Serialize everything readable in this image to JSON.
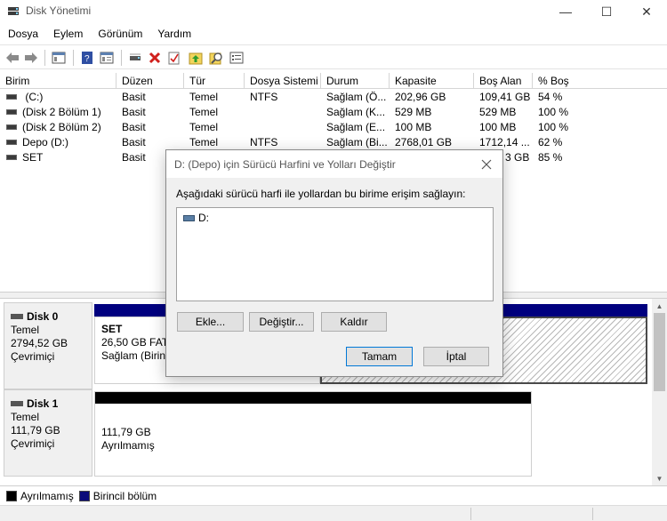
{
  "window": {
    "title": "Disk Yönetimi",
    "minimize_glyph": "—",
    "maximize_glyph": "☐",
    "close_glyph": "✕"
  },
  "menu": [
    "Dosya",
    "Eylem",
    "Görünüm",
    "Yardım"
  ],
  "toolbar": {
    "icons": [
      "back-icon",
      "forward-icon",
      "console-tree-icon",
      "help-icon",
      "properties-icon",
      "connect-icon",
      "delete-icon",
      "checkmark-icon",
      "rescan-icon",
      "search-icon",
      "settings-list-icon"
    ]
  },
  "volume_list": {
    "columns": [
      "Birim",
      "Düzen",
      "Tür",
      "Dosya Sistemi",
      "Durum",
      "Kapasite",
      "Boş Alan",
      "% Boş"
    ],
    "rows": [
      {
        "birim": " (C:)",
        "duzen": "Basit",
        "tur": "Temel",
        "dosya_sistemi": "NTFS",
        "durum": "Sağlam (Ö...",
        "kapasite": "202,96 GB",
        "bos_alan": "109,41 GB",
        "yuzde_bos": "54 %"
      },
      {
        "birim": "(Disk 2 Bölüm 1)",
        "duzen": "Basit",
        "tur": "Temel",
        "dosya_sistemi": "",
        "durum": "Sağlam (K...",
        "kapasite": "529 MB",
        "bos_alan": "529 MB",
        "yuzde_bos": "100 %"
      },
      {
        "birim": "(Disk 2 Bölüm 2)",
        "duzen": "Basit",
        "tur": "Temel",
        "dosya_sistemi": "",
        "durum": "Sağlam (E...",
        "kapasite": "100 MB",
        "bos_alan": "100 MB",
        "yuzde_bos": "100 %"
      },
      {
        "birim": "Depo (D:)",
        "duzen": "Basit",
        "tur": "Temel",
        "dosya_sistemi": "NTFS",
        "durum": "Sağlam (Bi...",
        "kapasite": "2768,01 GB",
        "bos_alan": "1712,14 ...",
        "yuzde_bos": "62 %"
      },
      {
        "birim": "SET",
        "duzen": "Basit",
        "tur": "",
        "dosya_sistemi": "",
        "durum": "",
        "kapasite": "",
        "bos_alan": "3 GB",
        "yuzde_bos": "85 %"
      }
    ]
  },
  "disks": [
    {
      "name": "Disk 0",
      "type": "Temel",
      "size": "2794,52 GB",
      "status": "Çevrimiçi",
      "partition": {
        "name": "SET",
        "detail": "26,50 GB FAT3",
        "status": "Sağlam (Birinc"
      }
    },
    {
      "name": "Disk 1",
      "type": "Temel",
      "size": "111,79 GB",
      "status": "Çevrimiçi",
      "partition": {
        "size": "111,79 GB",
        "status": "Ayrılmamış"
      }
    }
  ],
  "legend": [
    {
      "label": "Ayrılmamış",
      "color": "#000000"
    },
    {
      "label": "Birincil bölüm",
      "color": "#0a0a7a"
    }
  ],
  "colors": {
    "primary_partition": "#00007f",
    "unallocated": "#000000",
    "accent": "#0078d7"
  },
  "dialog": {
    "title": "D: (Depo) için Sürücü Harfini ve Yolları Değiştir",
    "description": "Aşağıdaki sürücü harfi ile yollardan bu birime erişim sağlayın:",
    "list_items": [
      "D:"
    ],
    "buttons": {
      "add": "Ekle...",
      "change": "Değiştir...",
      "remove": "Kaldır",
      "ok": "Tamam",
      "cancel": "İptal"
    }
  }
}
